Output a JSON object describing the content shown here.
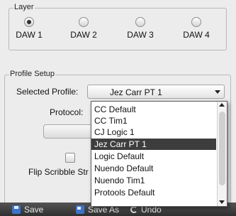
{
  "layer": {
    "title": "Layer",
    "options": [
      {
        "label": "DAW 1",
        "checked": true
      },
      {
        "label": "DAW 2",
        "checked": false
      },
      {
        "label": "DAW 3",
        "checked": false
      },
      {
        "label": "DAW 4",
        "checked": false
      }
    ]
  },
  "profile_setup": {
    "title": "Profile Setup",
    "selected_profile_label": "Selected Profile:",
    "selected_profile_value": "Jez Carr PT 1",
    "protocol_label": "Protocol:",
    "flip_scribble_label": "Flip Scribble Str",
    "flip_scribble_checked": false
  },
  "dropdown": {
    "items": [
      "CC Default",
      "CC Tim1",
      "CJ Logic 1",
      "Jez Carr PT 1",
      "Logic Default",
      "Nuendo Default",
      "Nuendo Tim1",
      "Protools Default"
    ],
    "selected_index": 3
  },
  "toolbar": {
    "save_label": "Save",
    "save_as_label": "Save As",
    "undo_label": "Undo",
    "save_icon": "floppy-disk-icon",
    "save_as_icon": "floppy-disk-icon",
    "undo_icon": "undo-icon"
  },
  "colors": {
    "window_background": "#ececec",
    "selection_background": "#3d3d3d",
    "toolbar_background": "#3a3a3a",
    "save_icon_blue": "#3b74c9"
  }
}
